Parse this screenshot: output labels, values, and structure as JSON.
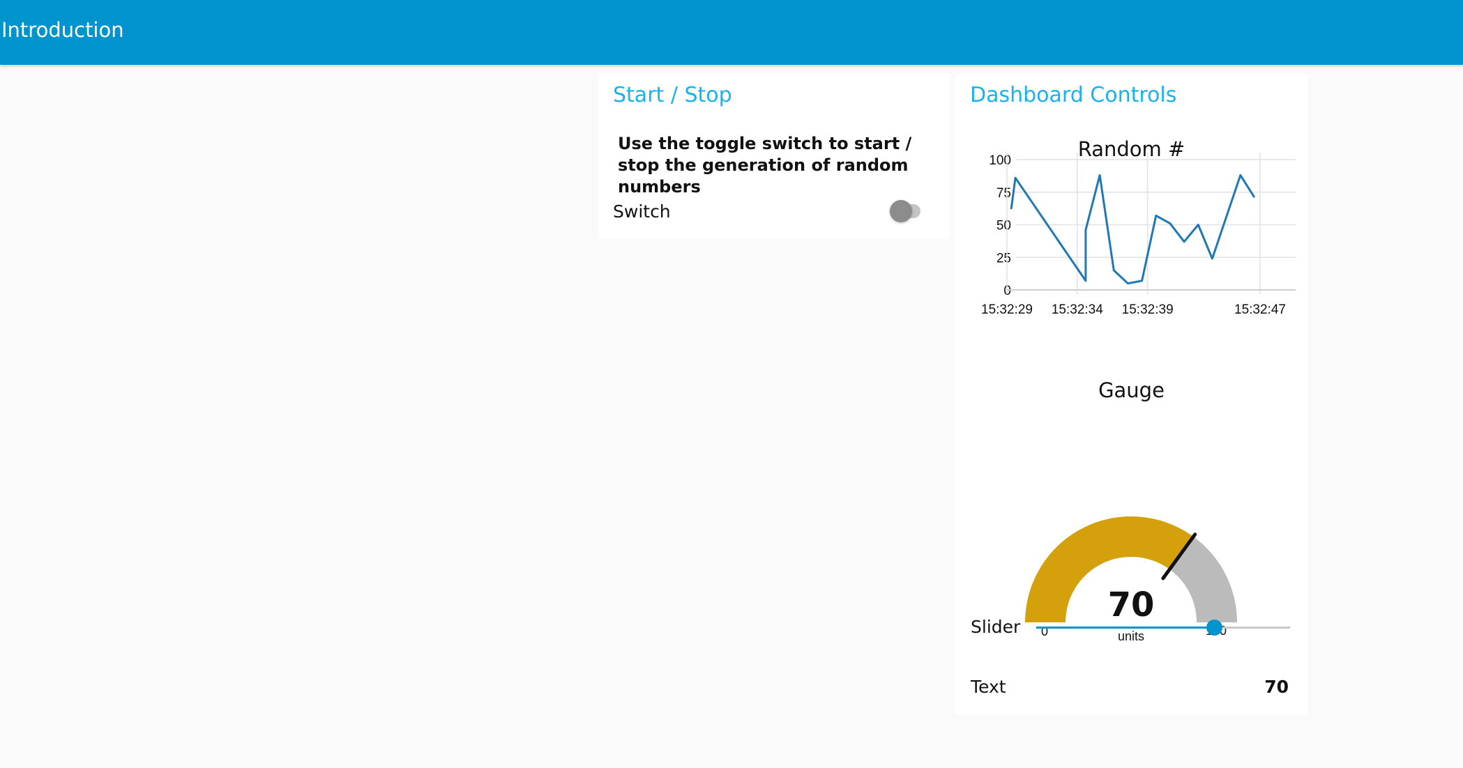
{
  "toolbar": {
    "title": "Introduction",
    "color": "#0094ce"
  },
  "start_stop": {
    "title": "Start / Stop",
    "instructions": "Use the toggle switch to start / stop the generation of random numbers",
    "switch_label": "Switch",
    "switch_on": false
  },
  "controls": {
    "title": "Dashboard Controls",
    "slider_label": "Slider",
    "slider_value": 70,
    "slider_min": 0,
    "slider_max": 100,
    "text_label": "Text",
    "text_value": "70"
  },
  "gauge": {
    "title": "Gauge",
    "value": "70",
    "units": "units",
    "min_label": "0",
    "max_label": "100",
    "fill_color": "#d4a00c",
    "empty_color": "#bbbbbb"
  },
  "chart_data": {
    "type": "line",
    "title": "Random #",
    "xlabel": "",
    "ylabel": "",
    "ylim": [
      0,
      100
    ],
    "yticks": [
      "0",
      "25",
      "50",
      "75",
      "100"
    ],
    "xticks": [
      "15:32:29",
      "15:32:34",
      "15:32:39",
      "15:32:47"
    ],
    "x": [
      "15:32:29.3",
      "15:32:29.6",
      "15:32:34.6",
      "15:32:34.6",
      "15:32:35.6",
      "15:32:36.6",
      "15:32:37.6",
      "15:32:38.6",
      "15:32:39.6",
      "15:32:40.6",
      "15:32:41.6",
      "15:32:42.6",
      "15:32:43.6",
      "15:32:45.6",
      "15:32:46.6"
    ],
    "series": [
      {
        "values": [
          62,
          86,
          7,
          46,
          88,
          15,
          5,
          7,
          57,
          51,
          37,
          50,
          24,
          88,
          71
        ],
        "color": "#1f77b4"
      }
    ],
    "grid": true
  }
}
